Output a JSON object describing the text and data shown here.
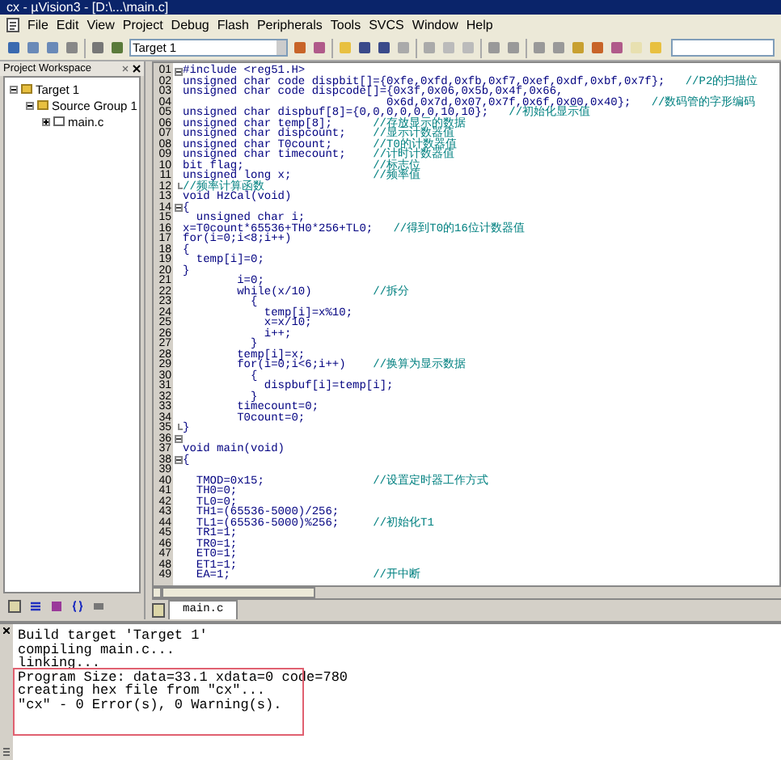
{
  "window": {
    "title": "cx - µVision3 - [D:\\...\\main.c]"
  },
  "menu": [
    "File",
    "Edit",
    "View",
    "Project",
    "Debug",
    "Flash",
    "Peripherals",
    "Tools",
    "SVCS",
    "Window",
    "Help"
  ],
  "toolbar": {
    "target": "Target 1"
  },
  "workspace": {
    "title": "Project Workspace",
    "tree": [
      {
        "label": "Target 1",
        "expanded": true,
        "children": [
          {
            "label": "Source Group 1",
            "expanded": true,
            "children": [
              {
                "label": "main.c",
                "expanded": false
              }
            ]
          }
        ]
      }
    ]
  },
  "editor": {
    "lines": [
      {
        "number": "01",
        "code": "#include <reg51.H>",
        "fold_open": true
      },
      {
        "number": "02",
        "code": "unsigned char code dispbit[]={0xfe,0xfd,0xfb,0xf7,0xef,0xdf,0xbf,0x7f};",
        "comment": "//P2的扫描位"
      },
      {
        "number": "03",
        "code": "unsigned char code dispcode[]={0x3f,0x06,0x5b,0x4f,0x66,"
      },
      {
        "number": "04",
        "code": "                              0x6d,0x7d,0x07,0x7f,0x6f,0x00,0x40};",
        "comment": "//数码管的字形编码"
      },
      {
        "number": "05",
        "code": "unsigned char dispbuf[8]={0,0,0,0,0,0,10,10};",
        "comment": "//初始化显示值"
      },
      {
        "number": "06",
        "code": "unsigned char temp[8];",
        "comment": "//存放显示的数据"
      },
      {
        "number": "07",
        "code": "unsigned char dispcount;",
        "comment": "//显示计数器值"
      },
      {
        "number": "08",
        "code": "unsigned char T0count;",
        "comment": "//T0的计数器值"
      },
      {
        "number": "09",
        "code": "unsigned char timecount;",
        "comment": "//计时计数器值"
      },
      {
        "number": "10",
        "code": "bit flag;",
        "comment": "//标志位"
      },
      {
        "number": "11",
        "code": "unsigned long x;",
        "comment": "//频率值"
      },
      {
        "number": "12",
        "comment": "//频率计算函数",
        "fold_end": true
      },
      {
        "number": "13",
        "code": "void HzCal(void)"
      },
      {
        "number": "14",
        "code": "{",
        "fold_open": true
      },
      {
        "number": "15",
        "code": "  unsigned char i;"
      },
      {
        "number": "16",
        "code": "x=T0count*65536+TH0*256+TL0;",
        "comment": "//得到T0的16位计数器值"
      },
      {
        "number": "17",
        "code": "for(i=0;i<8;i++)"
      },
      {
        "number": "18",
        "code": "{"
      },
      {
        "number": "19",
        "code": "  temp[i]=0;"
      },
      {
        "number": "20",
        "code": "}"
      },
      {
        "number": "21",
        "code": "        i=0;"
      },
      {
        "number": "22",
        "code": "        while(x/10)",
        "comment": "//拆分"
      },
      {
        "number": "23",
        "code": "          {"
      },
      {
        "number": "24",
        "code": "            temp[i]=x%10;"
      },
      {
        "number": "25",
        "code": "            x=x/10;"
      },
      {
        "number": "26",
        "code": "            i++;"
      },
      {
        "number": "27",
        "code": "          }"
      },
      {
        "number": "28",
        "code": "        temp[i]=x;"
      },
      {
        "number": "29",
        "code": "        for(i=0;i<6;i++)",
        "comment": "//换算为显示数据"
      },
      {
        "number": "30",
        "code": "          {"
      },
      {
        "number": "31",
        "code": "            dispbuf[i]=temp[i];"
      },
      {
        "number": "32",
        "code": "          }"
      },
      {
        "number": "33",
        "code": "        timecount=0;"
      },
      {
        "number": "34",
        "code": "        T0count=0;"
      },
      {
        "number": "35",
        "code": "}",
        "fold_end": true
      },
      {
        "number": "36",
        "fold_open": true
      },
      {
        "number": "37",
        "code": "void main(void)"
      },
      {
        "number": "38",
        "code": "{",
        "fold_open": true
      },
      {
        "number": "39"
      },
      {
        "number": "40",
        "code": "  TMOD=0x15;",
        "comment": "//设置定时器工作方式"
      },
      {
        "number": "41",
        "code": "  TH0=0;"
      },
      {
        "number": "42",
        "code": "  TL0=0;"
      },
      {
        "number": "43",
        "code": "  TH1=(65536-5000)/256;"
      },
      {
        "number": "44",
        "code": "  TL1=(65536-5000)%256;",
        "comment": "//初始化T1"
      },
      {
        "number": "45",
        "code": "  TR1=1;"
      },
      {
        "number": "46",
        "code": "  TR0=1;"
      },
      {
        "number": "47",
        "code": "  ET0=1;"
      },
      {
        "number": "48",
        "code": "  ET1=1;"
      },
      {
        "number": "49",
        "code": "  EA=1;",
        "comment": "//开中断"
      }
    ],
    "tabs": [
      {
        "label": "main.c",
        "selected": true
      }
    ]
  },
  "output": {
    "lines": [
      {
        "text": "Build target 'Target 1'",
        "boxed": false
      },
      {
        "text": "compiling main.c...",
        "boxed": false
      },
      {
        "text": "linking...",
        "boxed": false
      },
      {
        "text": "Program Size: data=33.1 xdata=0 code=780",
        "boxed": true
      },
      {
        "text": "creating hex file from \"cx\"...",
        "boxed": true
      },
      {
        "text": "\"cx\" - 0 Error(s), 0 Warning(s).",
        "boxed": true
      }
    ]
  }
}
